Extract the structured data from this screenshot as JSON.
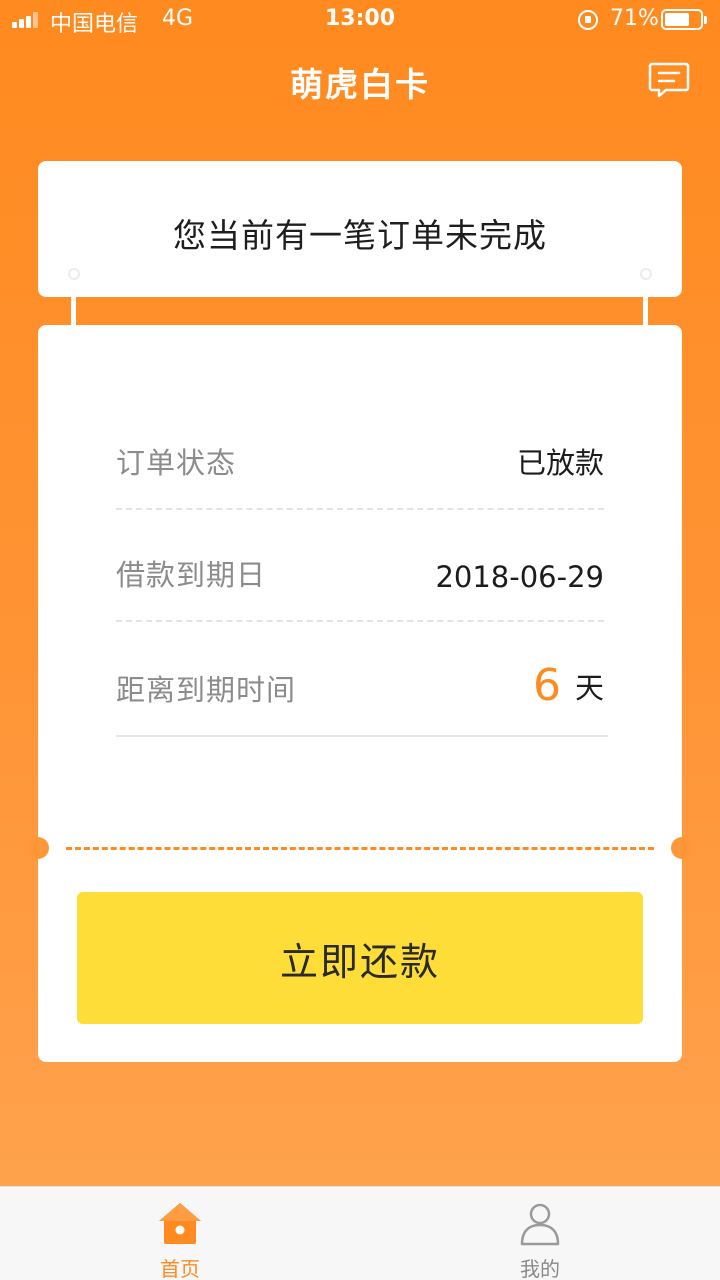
{
  "status_bar": {
    "carrier": "中国电信",
    "network": "4G",
    "time": "13:00",
    "battery_percent": "71%",
    "battery_level": 0.71
  },
  "header": {
    "title": "萌虎白卡",
    "message_icon": "message-icon"
  },
  "notice": {
    "text": "您当前有一笔订单未完成"
  },
  "order": {
    "rows": [
      {
        "label": "订单状态",
        "value": "已放款"
      },
      {
        "label": "借款到期日",
        "value": "2018-06-29"
      },
      {
        "label": "距离到期时间",
        "days": "6",
        "unit": "天"
      }
    ],
    "repay_button": "立即还款"
  },
  "tabs": [
    {
      "label": "首页",
      "icon": "home-icon",
      "active": true
    },
    {
      "label": "我的",
      "icon": "user-icon",
      "active": false
    }
  ],
  "colors": {
    "accent": "#ff8a1f",
    "button": "#fedd39",
    "tab_active": "#ff8a1f",
    "tab_inactive": "#8a8a8a"
  }
}
